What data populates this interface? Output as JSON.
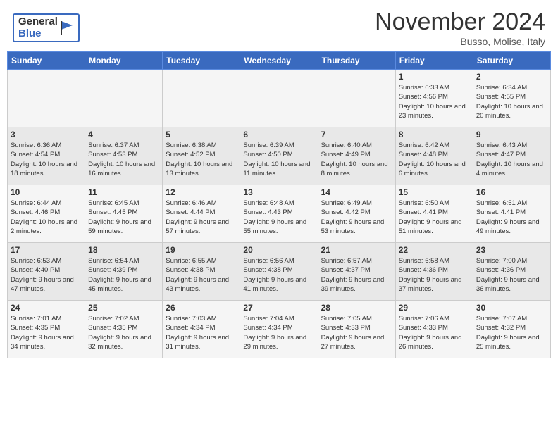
{
  "header": {
    "logo_general": "General",
    "logo_blue": "Blue",
    "month_title": "November 2024",
    "location": "Busso, Molise, Italy"
  },
  "calendar": {
    "days_of_week": [
      "Sunday",
      "Monday",
      "Tuesday",
      "Wednesday",
      "Thursday",
      "Friday",
      "Saturday"
    ],
    "weeks": [
      [
        {
          "day": "",
          "info": ""
        },
        {
          "day": "",
          "info": ""
        },
        {
          "day": "",
          "info": ""
        },
        {
          "day": "",
          "info": ""
        },
        {
          "day": "",
          "info": ""
        },
        {
          "day": "1",
          "info": "Sunrise: 6:33 AM\nSunset: 4:56 PM\nDaylight: 10 hours and 23 minutes."
        },
        {
          "day": "2",
          "info": "Sunrise: 6:34 AM\nSunset: 4:55 PM\nDaylight: 10 hours and 20 minutes."
        }
      ],
      [
        {
          "day": "3",
          "info": "Sunrise: 6:36 AM\nSunset: 4:54 PM\nDaylight: 10 hours and 18 minutes."
        },
        {
          "day": "4",
          "info": "Sunrise: 6:37 AM\nSunset: 4:53 PM\nDaylight: 10 hours and 16 minutes."
        },
        {
          "day": "5",
          "info": "Sunrise: 6:38 AM\nSunset: 4:52 PM\nDaylight: 10 hours and 13 minutes."
        },
        {
          "day": "6",
          "info": "Sunrise: 6:39 AM\nSunset: 4:50 PM\nDaylight: 10 hours and 11 minutes."
        },
        {
          "day": "7",
          "info": "Sunrise: 6:40 AM\nSunset: 4:49 PM\nDaylight: 10 hours and 8 minutes."
        },
        {
          "day": "8",
          "info": "Sunrise: 6:42 AM\nSunset: 4:48 PM\nDaylight: 10 hours and 6 minutes."
        },
        {
          "day": "9",
          "info": "Sunrise: 6:43 AM\nSunset: 4:47 PM\nDaylight: 10 hours and 4 minutes."
        }
      ],
      [
        {
          "day": "10",
          "info": "Sunrise: 6:44 AM\nSunset: 4:46 PM\nDaylight: 10 hours and 2 minutes."
        },
        {
          "day": "11",
          "info": "Sunrise: 6:45 AM\nSunset: 4:45 PM\nDaylight: 9 hours and 59 minutes."
        },
        {
          "day": "12",
          "info": "Sunrise: 6:46 AM\nSunset: 4:44 PM\nDaylight: 9 hours and 57 minutes."
        },
        {
          "day": "13",
          "info": "Sunrise: 6:48 AM\nSunset: 4:43 PM\nDaylight: 9 hours and 55 minutes."
        },
        {
          "day": "14",
          "info": "Sunrise: 6:49 AM\nSunset: 4:42 PM\nDaylight: 9 hours and 53 minutes."
        },
        {
          "day": "15",
          "info": "Sunrise: 6:50 AM\nSunset: 4:41 PM\nDaylight: 9 hours and 51 minutes."
        },
        {
          "day": "16",
          "info": "Sunrise: 6:51 AM\nSunset: 4:41 PM\nDaylight: 9 hours and 49 minutes."
        }
      ],
      [
        {
          "day": "17",
          "info": "Sunrise: 6:53 AM\nSunset: 4:40 PM\nDaylight: 9 hours and 47 minutes."
        },
        {
          "day": "18",
          "info": "Sunrise: 6:54 AM\nSunset: 4:39 PM\nDaylight: 9 hours and 45 minutes."
        },
        {
          "day": "19",
          "info": "Sunrise: 6:55 AM\nSunset: 4:38 PM\nDaylight: 9 hours and 43 minutes."
        },
        {
          "day": "20",
          "info": "Sunrise: 6:56 AM\nSunset: 4:38 PM\nDaylight: 9 hours and 41 minutes."
        },
        {
          "day": "21",
          "info": "Sunrise: 6:57 AM\nSunset: 4:37 PM\nDaylight: 9 hours and 39 minutes."
        },
        {
          "day": "22",
          "info": "Sunrise: 6:58 AM\nSunset: 4:36 PM\nDaylight: 9 hours and 37 minutes."
        },
        {
          "day": "23",
          "info": "Sunrise: 7:00 AM\nSunset: 4:36 PM\nDaylight: 9 hours and 36 minutes."
        }
      ],
      [
        {
          "day": "24",
          "info": "Sunrise: 7:01 AM\nSunset: 4:35 PM\nDaylight: 9 hours and 34 minutes."
        },
        {
          "day": "25",
          "info": "Sunrise: 7:02 AM\nSunset: 4:35 PM\nDaylight: 9 hours and 32 minutes."
        },
        {
          "day": "26",
          "info": "Sunrise: 7:03 AM\nSunset: 4:34 PM\nDaylight: 9 hours and 31 minutes."
        },
        {
          "day": "27",
          "info": "Sunrise: 7:04 AM\nSunset: 4:34 PM\nDaylight: 9 hours and 29 minutes."
        },
        {
          "day": "28",
          "info": "Sunrise: 7:05 AM\nSunset: 4:33 PM\nDaylight: 9 hours and 27 minutes."
        },
        {
          "day": "29",
          "info": "Sunrise: 7:06 AM\nSunset: 4:33 PM\nDaylight: 9 hours and 26 minutes."
        },
        {
          "day": "30",
          "info": "Sunrise: 7:07 AM\nSunset: 4:32 PM\nDaylight: 9 hours and 25 minutes."
        }
      ]
    ]
  }
}
